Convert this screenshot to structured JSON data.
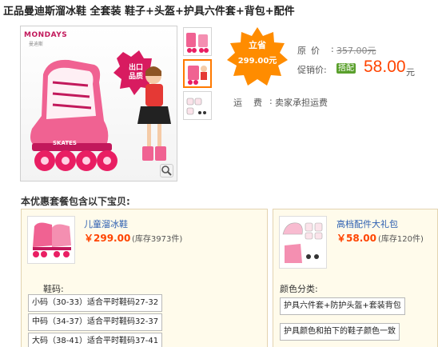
{
  "header": {
    "title": "正品曼迪斯溜冰鞋 全套装 鞋子+头盔+护具六件套+背包+配件"
  },
  "gallery": {
    "brand": "MONDAYS",
    "brand_sub": "曼迪斯",
    "badge_line1": "出口",
    "badge_line2": "品质",
    "skate_text": "SKATES"
  },
  "promo_burst": {
    "line1": "立省",
    "line2": "299.00元",
    "color": "#ff8c00"
  },
  "price": {
    "original_label": "原价",
    "original_value": "357.00元",
    "promo_label": "促销价",
    "promo_badge": "搭配",
    "promo_value": "58.00",
    "promo_unit": "元",
    "accent": "#ff4400"
  },
  "shipping": {
    "label": "运费",
    "value": "卖家承担运费"
  },
  "combo": {
    "title": "本优惠套餐包含以下宝贝:",
    "left": {
      "name": "儿童溜冰鞋",
      "price": "￥299.00",
      "stock": "(库存3973件)",
      "option_label": "鞋码:",
      "options": [
        "小码（30-33）适合平时鞋码27-32",
        "中码（34-37）适合平时鞋码32-37",
        "大码（38-41）适合平时鞋码37-41"
      ]
    },
    "right": {
      "name": "高档配件大礼包",
      "price": "￥58.00",
      "stock": "(库存120件)",
      "option_label": "颜色分类:",
      "options": [
        "护具六件套+防护头盔+套装背包",
        "护具颜色和拍下的鞋子颜色一致"
      ]
    }
  }
}
